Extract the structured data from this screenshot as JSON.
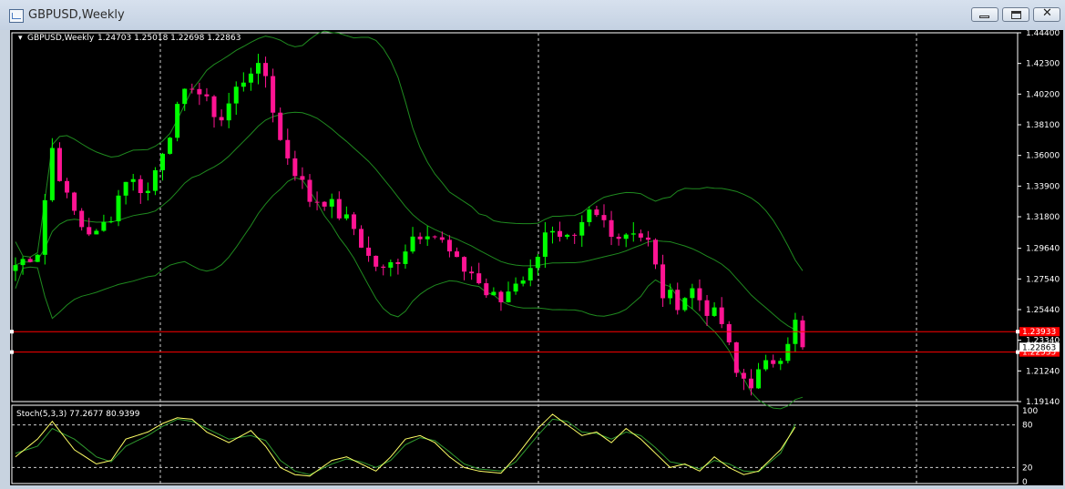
{
  "window": {
    "title": "GBPUSD,Weekly",
    "buttons": {
      "minimize": "minimize",
      "restore": "restore",
      "close": "✕"
    }
  },
  "chart": {
    "header": {
      "symbol": "GBPUSD,Weekly",
      "ohlc": "1.24703 1.25018 1.22698 1.22863"
    },
    "price_axis": {
      "labels": [
        "1.44400",
        "1.42300",
        "1.40200",
        "1.38100",
        "1.36000",
        "1.33900",
        "1.31800",
        "1.29640",
        "1.27540",
        "1.25440",
        "1.23340",
        "1.21240",
        "1.19140"
      ]
    },
    "levels": [
      {
        "price": 1.2393,
        "label": "1.23933",
        "color": "#ff0000"
      },
      {
        "price": 1.2253,
        "label": "1.22535",
        "color": "#ff0000"
      }
    ],
    "current_price": {
      "price": 1.22863,
      "label": "1.22863"
    },
    "colors": {
      "bull": "#00ff00",
      "bear": "#ff1493",
      "bands": "#1f8a1f",
      "stoch_main": "#ffff66",
      "stoch_signal": "#2f9a2f",
      "level": "#ff0000"
    },
    "stochastic": {
      "header": "Stoch(5,3,3) 77.2677 80.9399",
      "axis_labels": [
        "100",
        "80",
        "20",
        "0"
      ]
    }
  },
  "chart_data": {
    "type": "candlestick",
    "symbol": "GBPUSD",
    "timeframe": "Weekly",
    "ylim": [
      1.1914,
      1.444
    ],
    "indicators": [
      "Bollinger Bands",
      "Stochastic(5,3,3)"
    ],
    "last_candle": {
      "open": 1.24703,
      "high": 1.25018,
      "low": 1.22698,
      "close": 1.22863
    },
    "close_path": [
      [
        0,
        1.285
      ],
      [
        3,
        1.295
      ],
      [
        5,
        1.365
      ],
      [
        7,
        1.33
      ],
      [
        9,
        1.312
      ],
      [
        11,
        1.305
      ],
      [
        13,
        1.32
      ],
      [
        15,
        1.345
      ],
      [
        18,
        1.335
      ],
      [
        20,
        1.365
      ],
      [
        22,
        1.39
      ],
      [
        24,
        1.41
      ],
      [
        26,
        1.395
      ],
      [
        28,
        1.385
      ],
      [
        30,
        1.405
      ],
      [
        32,
        1.42
      ],
      [
        34,
        1.415
      ],
      [
        36,
        1.37
      ],
      [
        38,
        1.35
      ],
      [
        40,
        1.33
      ],
      [
        42,
        1.33
      ],
      [
        44,
        1.32
      ],
      [
        46,
        1.31
      ],
      [
        48,
        1.29
      ],
      [
        50,
        1.28
      ],
      [
        52,
        1.29
      ],
      [
        54,
        1.305
      ],
      [
        56,
        1.31
      ],
      [
        58,
        1.3
      ],
      [
        60,
        1.285
      ],
      [
        62,
        1.28
      ],
      [
        64,
        1.265
      ],
      [
        66,
        1.26
      ],
      [
        68,
        1.275
      ],
      [
        70,
        1.28
      ],
      [
        72,
        1.31
      ],
      [
        74,
        1.3
      ],
      [
        76,
        1.3
      ],
      [
        78,
        1.32
      ],
      [
        80,
        1.315
      ],
      [
        82,
        1.305
      ],
      [
        84,
        1.31
      ],
      [
        86,
        1.3
      ],
      [
        88,
        1.265
      ],
      [
        90,
        1.26
      ],
      [
        92,
        1.268
      ],
      [
        94,
        1.255
      ],
      [
        96,
        1.245
      ],
      [
        98,
        1.21
      ],
      [
        100,
        1.205
      ],
      [
        102,
        1.215
      ],
      [
        104,
        1.225
      ],
      [
        106,
        1.245
      ],
      [
        107,
        1.2286
      ]
    ],
    "stoch_main": [
      [
        0,
        35
      ],
      [
        3,
        60
      ],
      [
        5,
        85
      ],
      [
        8,
        45
      ],
      [
        11,
        25
      ],
      [
        13,
        30
      ],
      [
        15,
        60
      ],
      [
        18,
        70
      ],
      [
        20,
        82
      ],
      [
        22,
        90
      ],
      [
        24,
        88
      ],
      [
        26,
        70
      ],
      [
        29,
        55
      ],
      [
        32,
        72
      ],
      [
        34,
        50
      ],
      [
        36,
        20
      ],
      [
        38,
        10
      ],
      [
        40,
        8
      ],
      [
        43,
        30
      ],
      [
        45,
        35
      ],
      [
        47,
        25
      ],
      [
        49,
        15
      ],
      [
        51,
        35
      ],
      [
        53,
        60
      ],
      [
        55,
        65
      ],
      [
        57,
        55
      ],
      [
        59,
        35
      ],
      [
        61,
        20
      ],
      [
        63,
        15
      ],
      [
        66,
        12
      ],
      [
        68,
        35
      ],
      [
        71,
        75
      ],
      [
        73,
        95
      ],
      [
        75,
        80
      ],
      [
        77,
        65
      ],
      [
        79,
        70
      ],
      [
        81,
        55
      ],
      [
        83,
        75
      ],
      [
        85,
        60
      ],
      [
        87,
        40
      ],
      [
        89,
        20
      ],
      [
        91,
        25
      ],
      [
        93,
        15
      ],
      [
        95,
        35
      ],
      [
        97,
        20
      ],
      [
        99,
        10
      ],
      [
        101,
        15
      ],
      [
        104,
        45
      ],
      [
        106,
        77
      ]
    ],
    "stoch_signal": [
      [
        0,
        40
      ],
      [
        3,
        50
      ],
      [
        5,
        75
      ],
      [
        8,
        60
      ],
      [
        11,
        35
      ],
      [
        13,
        28
      ],
      [
        15,
        50
      ],
      [
        18,
        65
      ],
      [
        20,
        78
      ],
      [
        22,
        88
      ],
      [
        24,
        85
      ],
      [
        26,
        75
      ],
      [
        29,
        60
      ],
      [
        32,
        65
      ],
      [
        34,
        58
      ],
      [
        36,
        30
      ],
      [
        38,
        15
      ],
      [
        40,
        10
      ],
      [
        43,
        25
      ],
      [
        45,
        32
      ],
      [
        47,
        28
      ],
      [
        49,
        20
      ],
      [
        51,
        30
      ],
      [
        53,
        52
      ],
      [
        55,
        62
      ],
      [
        57,
        58
      ],
      [
        59,
        42
      ],
      [
        61,
        25
      ],
      [
        63,
        18
      ],
      [
        66,
        15
      ],
      [
        68,
        28
      ],
      [
        71,
        65
      ],
      [
        73,
        88
      ],
      [
        75,
        85
      ],
      [
        77,
        70
      ],
      [
        79,
        68
      ],
      [
        81,
        60
      ],
      [
        83,
        70
      ],
      [
        85,
        65
      ],
      [
        87,
        48
      ],
      [
        89,
        28
      ],
      [
        91,
        24
      ],
      [
        93,
        18
      ],
      [
        95,
        30
      ],
      [
        97,
        25
      ],
      [
        99,
        15
      ],
      [
        101,
        14
      ],
      [
        104,
        40
      ],
      [
        106,
        81
      ]
    ]
  }
}
